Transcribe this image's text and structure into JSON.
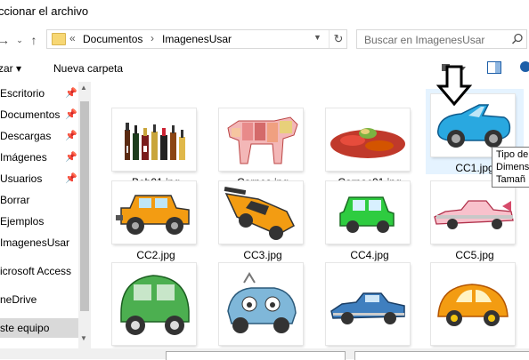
{
  "window": {
    "title": "ccionar el archivo"
  },
  "address": {
    "prefix": "«",
    "crumbs": [
      "Documentos",
      "ImagenesUsar"
    ],
    "separator": "›"
  },
  "search": {
    "placeholder": "Buscar en ImagenesUsar"
  },
  "toolbar": {
    "organize": "zar ▾",
    "new_folder": "Nueva carpeta"
  },
  "sidebar": {
    "items": [
      {
        "label": "Escritorio",
        "pinned": true
      },
      {
        "label": "Documentos",
        "pinned": true
      },
      {
        "label": "Descargas",
        "pinned": true
      },
      {
        "label": "Imágenes",
        "pinned": true
      },
      {
        "label": "Usuarios",
        "pinned": true
      },
      {
        "label": "Borrar",
        "pinned": false
      },
      {
        "label": "Ejemplos",
        "pinned": false
      },
      {
        "label": "ImagenesUsar",
        "pinned": false
      },
      {
        "label": "icrosoft Access",
        "pinned": false
      },
      {
        "label": "neDrive",
        "pinned": false
      },
      {
        "label": "ste equipo",
        "pinned": false,
        "selected": true
      }
    ]
  },
  "files": [
    {
      "name": "Beb01.jpg",
      "icon": "bottles-image"
    },
    {
      "name": "Carnes.jpg",
      "icon": "beef-cuts-image"
    },
    {
      "name": "Carpac01.jpg",
      "icon": "carpaccio-image"
    },
    {
      "name": "CC1.jpg",
      "icon": "blue-convertible-image"
    },
    {
      "name": "CC2.jpg",
      "icon": "orange-jeep-image"
    },
    {
      "name": "CC3.jpg",
      "icon": "orange-sports-car-image"
    },
    {
      "name": "CC4.jpg",
      "icon": "green-mini-image"
    },
    {
      "name": "CC5.jpg",
      "icon": "pink-cadillac-image"
    },
    {
      "name": "",
      "icon": "green-2cv-image"
    },
    {
      "name": "",
      "icon": "wrecked-car-image"
    },
    {
      "name": "",
      "icon": "blue-classic-car-image"
    },
    {
      "name": "",
      "icon": "orange-beetle-image"
    }
  ],
  "tooltip": {
    "lines": [
      "Tipo de",
      "Dimens",
      "Tamañ"
    ]
  },
  "colors": {
    "selection": "#d9d9d9",
    "hover": "#e5f3ff",
    "folder": "#f7d774"
  }
}
